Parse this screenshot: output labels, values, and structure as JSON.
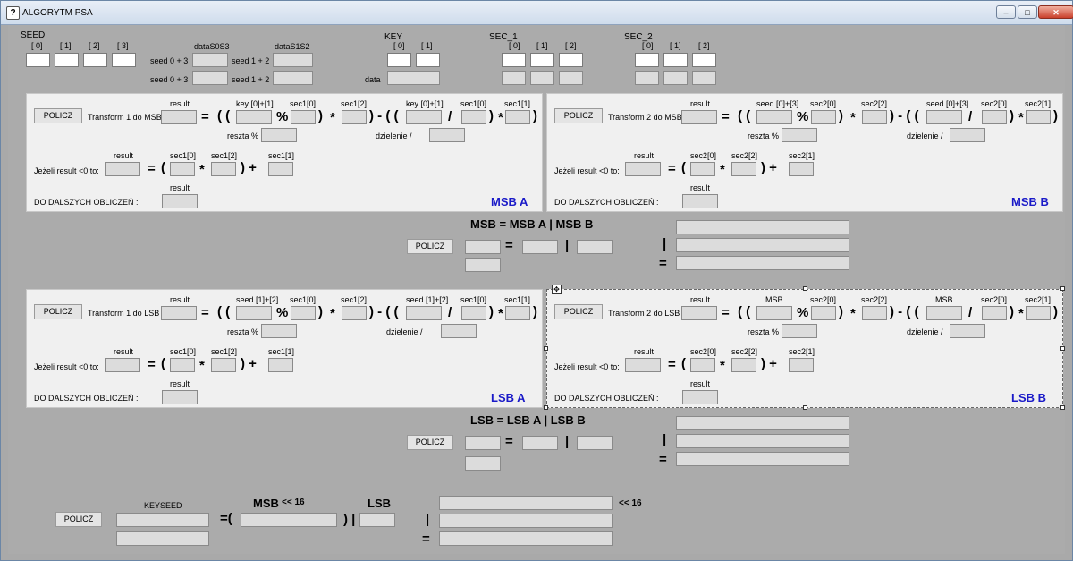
{
  "window": {
    "title": "ALGORYTM PSA",
    "icon_glyph": "?",
    "minimize": "–",
    "maximize": "□",
    "close": "✕"
  },
  "seed": {
    "label": "SEED",
    "indices": [
      "[ 0]",
      "[ 1]",
      "[ 2]",
      "[ 3]"
    ],
    "dataS0S3": "dataS0S3",
    "dataS1S2": "dataS1S2",
    "seed03": "seed 0 + 3",
    "seed12": "seed 1 + 2"
  },
  "key": {
    "label": "KEY",
    "indices": [
      "[ 0]",
      "[ 1]"
    ],
    "data": "data"
  },
  "sec1": {
    "label": "SEC_1",
    "indices": [
      "[ 0]",
      "[ 1]",
      "[ 2]"
    ]
  },
  "sec2": {
    "label": "SEC_2",
    "indices": [
      "[ 0]",
      "[ 1]",
      "[ 2]"
    ]
  },
  "common": {
    "policz": "POLICZ",
    "result": "result",
    "reszta": "reszta %",
    "dzielenie": "dzielenie /",
    "jezeli": "Jeżeli result <0 to:",
    "dalszych": "DO DALSZYCH OBLICZEŃ :",
    "eq": "=",
    "open2": "( (",
    "close1": ")",
    "minus_open": ") - ( (",
    "pct": "%",
    "slash": "/",
    "times": "*",
    "open": "(",
    "plus": ") +",
    "pipe": "|",
    "shl16": "<< 16"
  },
  "msbA": {
    "title": "MSB A",
    "transform": "Transform 1 do MSB",
    "h1": "key [0]+[1]",
    "h2": "sec1[0]",
    "h3": "sec1[2]",
    "h4": "key [0]+[1]",
    "h5": "sec1[0]",
    "h6": "sec1[1]",
    "n1": "sec1[0]",
    "n2": "sec1[2]",
    "n3": "sec1[1]"
  },
  "msbB": {
    "title": "MSB B",
    "transform": "Transform 2 do MSB",
    "h1": "seed [0]+[3]",
    "h2": "sec2[0]",
    "h3": "sec2[2]",
    "h4": "seed [0]+[3]",
    "h5": "sec2[0]",
    "h6": "sec2[1]",
    "n1": "sec2[0]",
    "n2": "sec2[2]",
    "n3": "sec2[1]"
  },
  "lsbA": {
    "title": "LSB A",
    "transform": "Transform 1 do LSB",
    "h1": "seed [1]+[2]",
    "h2": "sec1[0]",
    "h3": "sec1[2]",
    "h4": "seed [1]+[2]",
    "h5": "sec1[0]",
    "h6": "sec1[1]",
    "n1": "sec1[0]",
    "n2": "sec1[2]",
    "n3": "sec1[1]"
  },
  "lsbB": {
    "title": "LSB B",
    "transform": "Transform 2 do LSB",
    "h1": "MSB",
    "h2": "sec2[0]",
    "h3": "sec2[2]",
    "h4": "MSB",
    "h5": "sec2[0]",
    "h6": "sec2[1]",
    "n1": "sec2[0]",
    "n2": "sec2[2]",
    "n3": "sec2[1]"
  },
  "msb": {
    "formula": "MSB  =  MSB A  |  MSB B"
  },
  "lsb": {
    "formula": "LSB  =  LSB A  |  LSB B"
  },
  "keyseed": {
    "label": "KEYSEED",
    "msb": "MSB",
    "lsb": "LSB",
    "shl_label": "<<  16"
  }
}
